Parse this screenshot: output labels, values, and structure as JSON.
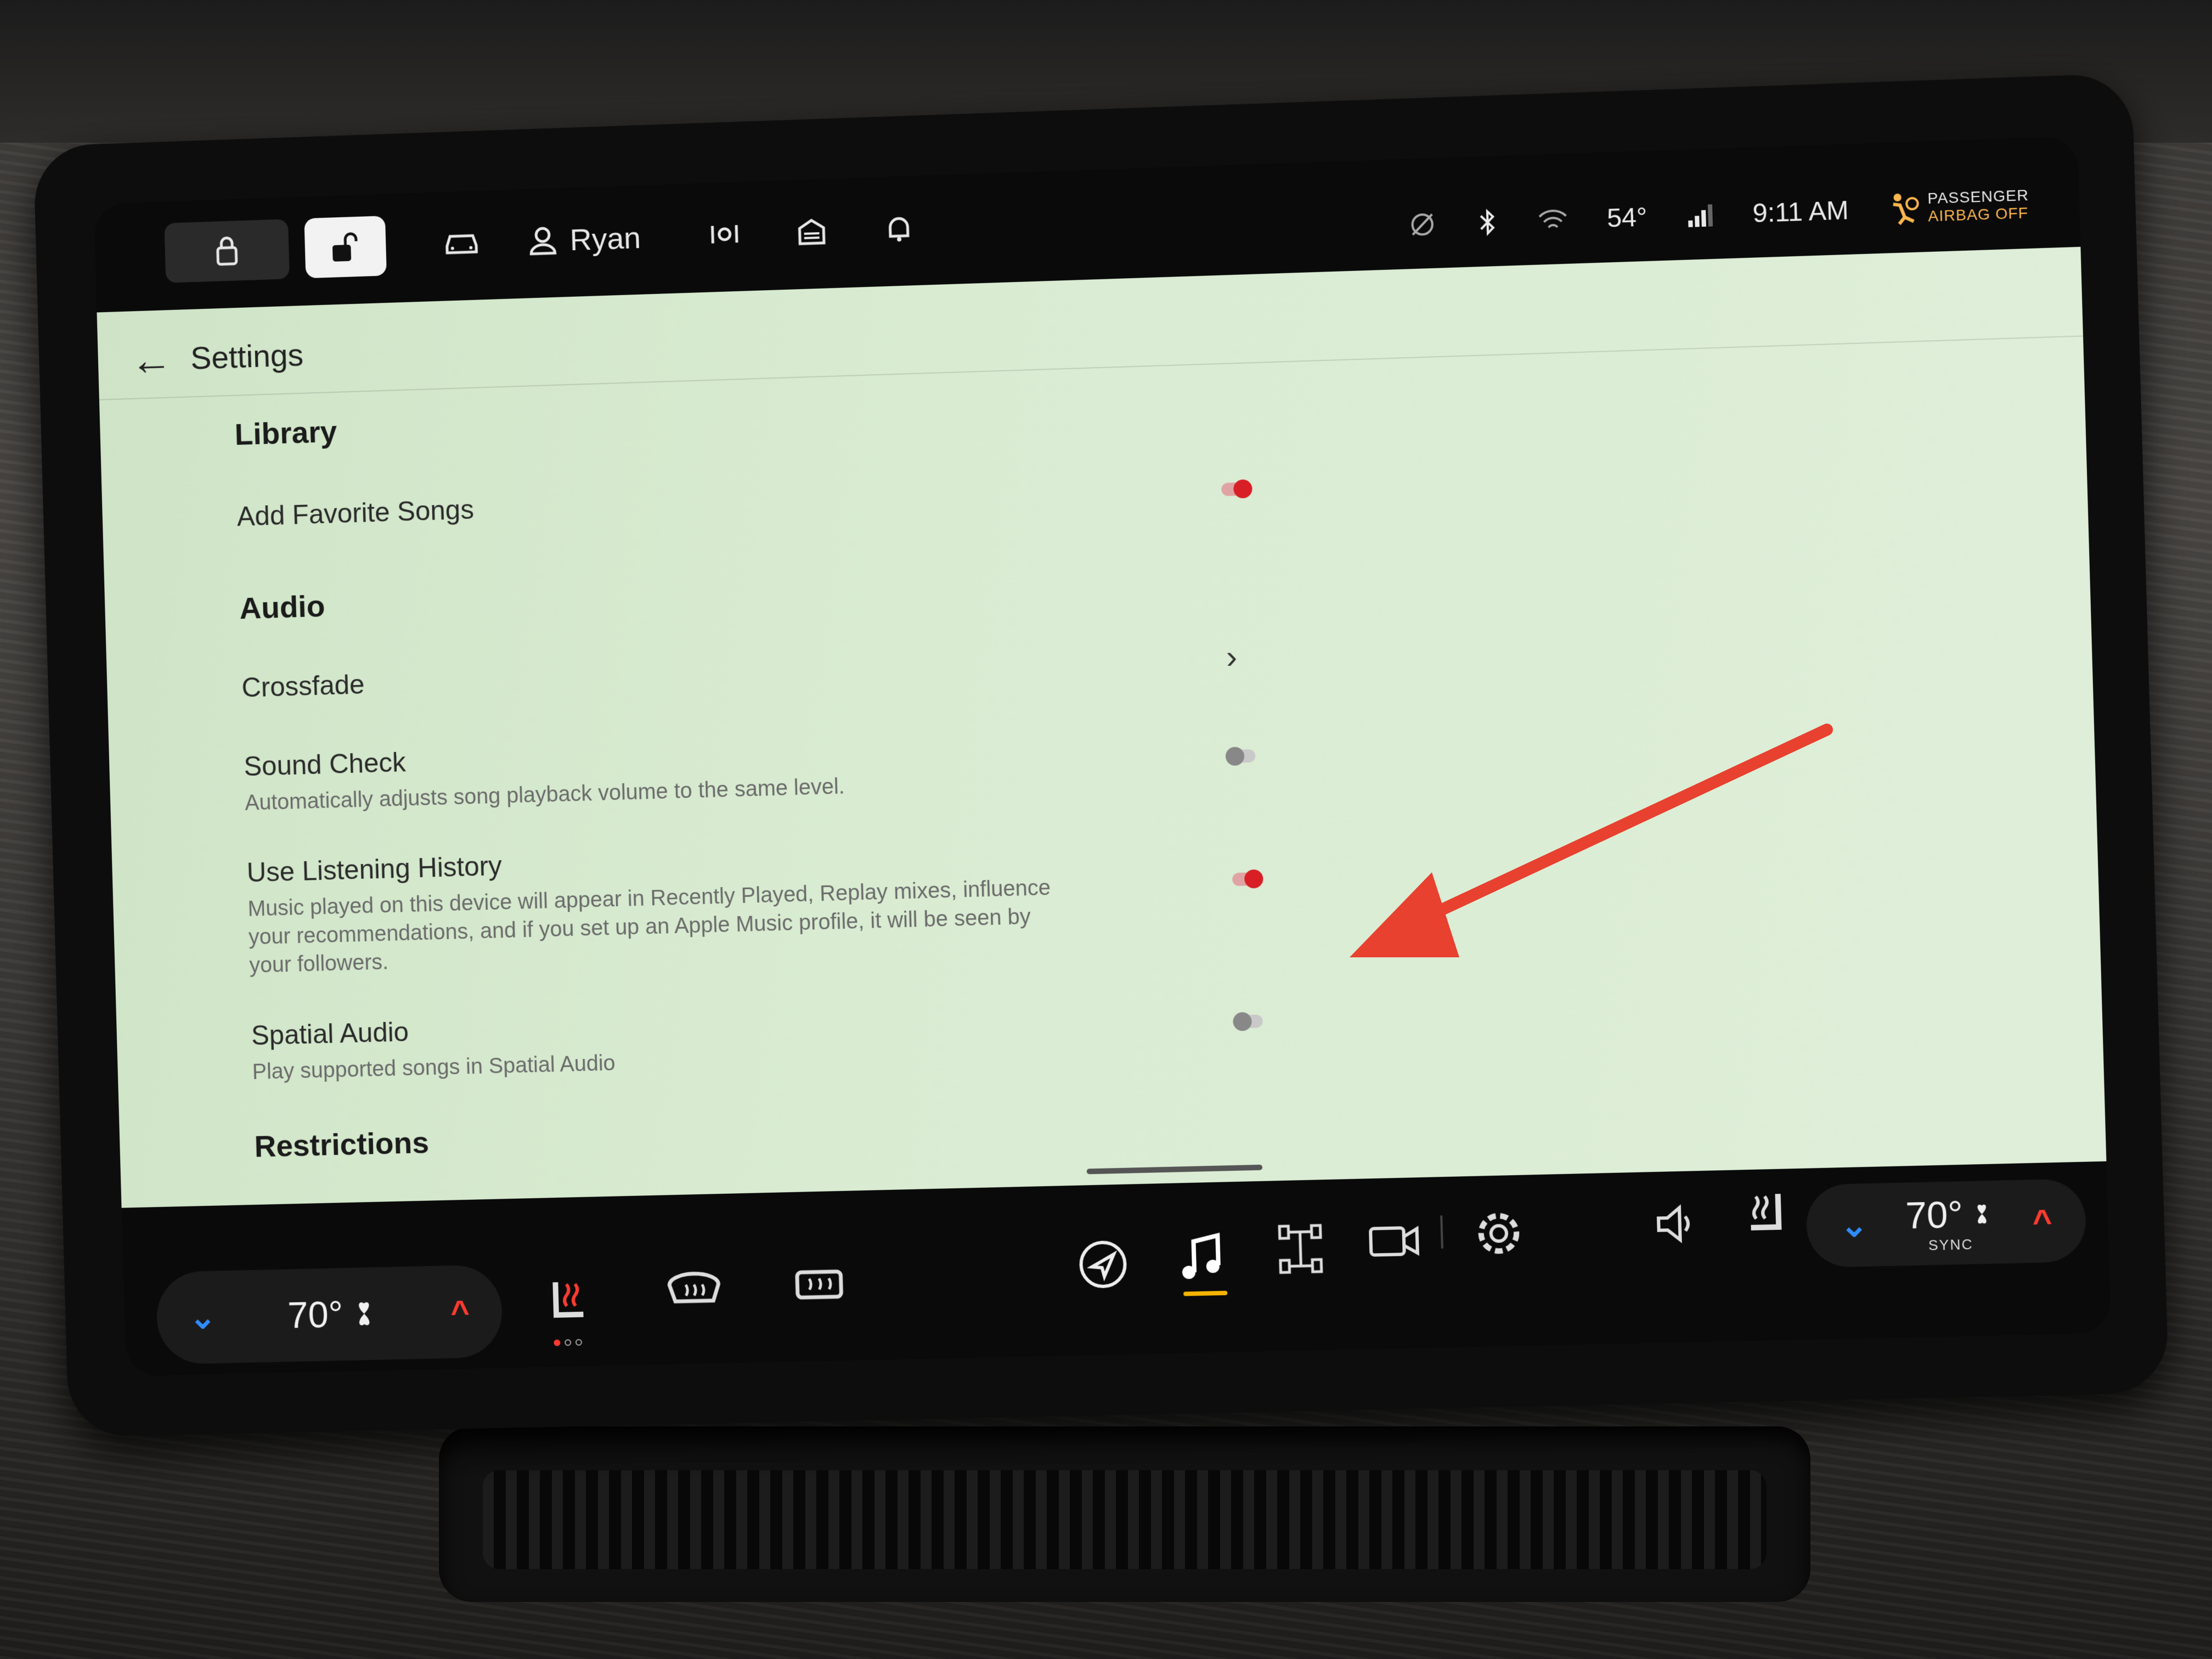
{
  "topbar": {
    "profile_name": "Ryan"
  },
  "status": {
    "temperature": "54°",
    "time": "9:11 AM",
    "airbag_line1": "PASSENGER",
    "airbag_line2": "AIRBAG OFF"
  },
  "header": {
    "title": "Settings"
  },
  "sections": {
    "library": "Library",
    "audio": "Audio",
    "restrictions": "Restrictions"
  },
  "rows": {
    "add_favorite": {
      "label": "Add Favorite Songs",
      "state": "on"
    },
    "crossfade": {
      "label": "Crossfade"
    },
    "sound_check": {
      "label": "Sound Check",
      "desc": "Automatically adjusts song playback volume to the same level.",
      "state": "off"
    },
    "listening_history": {
      "label": "Use Listening History",
      "desc": "Music played on this device will appear in Recently Played, Replay mixes, influence your recommendations, and if you set up an Apple Music profile, it will be seen by your followers.",
      "state": "on"
    },
    "spatial_audio": {
      "label": "Spatial Audio",
      "desc": "Play supported songs in Spatial Audio",
      "state": "off"
    }
  },
  "climate": {
    "left_temp": "70°",
    "right_temp": "70°",
    "sync_label": "SYNC"
  },
  "colors": {
    "accent_red": "#d81f26",
    "annotation_red": "#e8412f",
    "music_active": "#f5b400",
    "down_blue": "#2f8cff"
  },
  "icons": [
    "lock-icon",
    "unlock-icon",
    "car-icon",
    "user-icon",
    "camera-icon",
    "garage-icon",
    "bell-icon",
    "navigation-icon",
    "music-icon",
    "drive-icon",
    "video-icon",
    "gear-icon",
    "volume-icon",
    "seat-heat-icon",
    "defrost-front-icon",
    "defrost-rear-icon",
    "fan-icon"
  ]
}
